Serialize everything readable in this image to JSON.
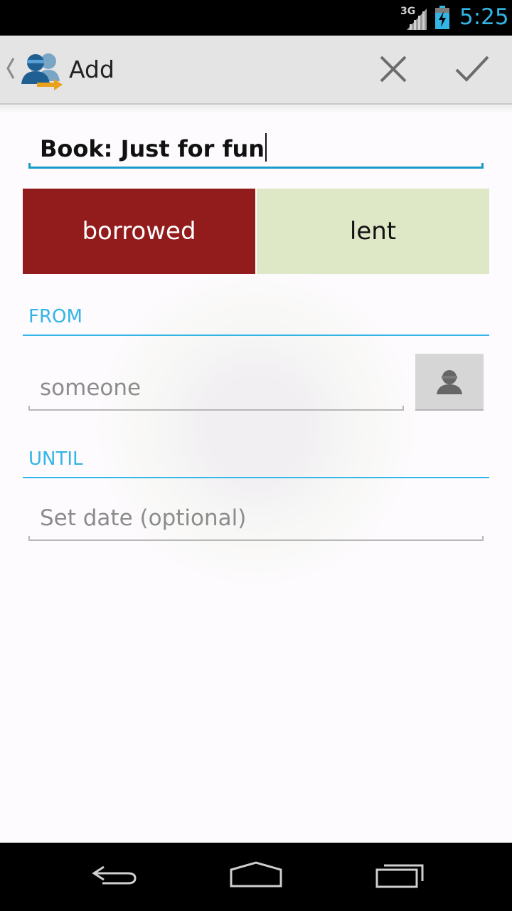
{
  "status_bar": {
    "network": "3G",
    "time": "5:25",
    "icons": [
      "signal-icon",
      "battery-charging-icon"
    ]
  },
  "action_bar": {
    "title": "Add",
    "icons": [
      "back-chevron-icon",
      "app-people-exchange-icon",
      "close-icon",
      "checkmark-icon"
    ]
  },
  "form": {
    "title_value": "Book: Just for fun",
    "toggle": {
      "options": [
        "borrowed",
        "lent"
      ],
      "selected": "borrowed",
      "selected_color": "#921b1b",
      "unselected_color": "#dee8c6"
    },
    "from_section": {
      "label": "FROM",
      "person_placeholder": "someone",
      "contact_button_icon": "contact-person-icon"
    },
    "until_section": {
      "label": "UNTIL",
      "date_placeholder": "Set date (optional)"
    },
    "accent_color": "#33b5e5"
  },
  "nav_bar": {
    "icons": [
      "back-icon",
      "home-icon",
      "recent-apps-icon"
    ]
  }
}
